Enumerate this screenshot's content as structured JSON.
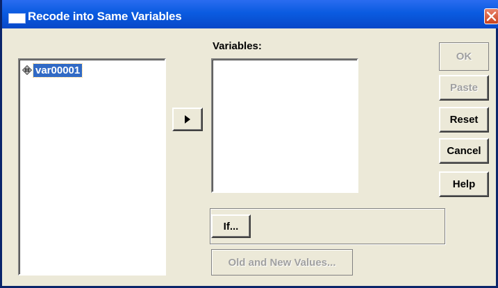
{
  "window": {
    "title": "Recode into Same Variables",
    "icons": {
      "window": "window-icon",
      "close": "close-icon"
    }
  },
  "source_list": {
    "items": [
      {
        "label": "var00001",
        "icon": "numeric-variable-icon",
        "selected": true
      }
    ]
  },
  "move_button": {
    "icon": "arrow-right-icon"
  },
  "variables": {
    "label": "Variables:",
    "items": []
  },
  "buttons": {
    "ok": {
      "label": "OK",
      "enabled": false
    },
    "paste": {
      "label": "Paste",
      "enabled": false
    },
    "reset": {
      "label": "Reset",
      "enabled": true
    },
    "cancel": {
      "label": "Cancel",
      "enabled": true
    },
    "help": {
      "label": "Help",
      "enabled": true
    },
    "if": {
      "label": "If...",
      "enabled": true
    },
    "old_new": {
      "label": "Old and New Values...",
      "enabled": false
    }
  },
  "colors": {
    "titlebar": "#0a5be0",
    "dialog_bg": "#ece9d8",
    "selection": "#316ac5",
    "close": "#c9441f"
  }
}
